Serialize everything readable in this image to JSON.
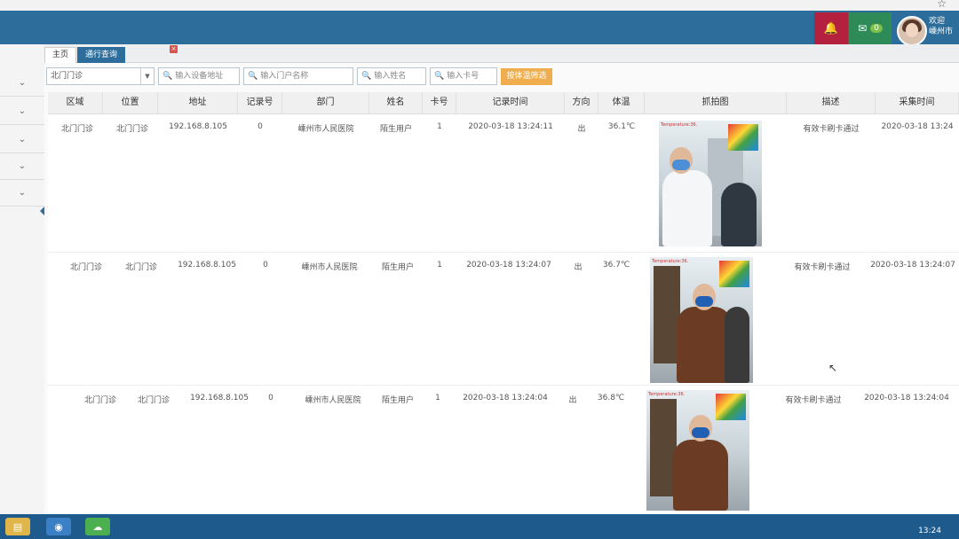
{
  "header": {
    "notifications_icon": "bell-icon",
    "mail_icon": "mail-icon",
    "mail_count": "0",
    "welcome_line1": "欢迎",
    "welcome_line2": "嵊州市"
  },
  "tabs": [
    {
      "label": "主页"
    },
    {
      "label": "通行查询"
    }
  ],
  "tab_close_glyph": "×",
  "filters": {
    "area_select": "北门门诊",
    "device_placeholder": "输入设备地址",
    "door_placeholder": "输入门户名称",
    "name_placeholder": "输入姓名",
    "card_placeholder": "输入卡号",
    "search_button": "按体温筛选"
  },
  "table": {
    "columns": [
      "区域",
      "位置",
      "地址",
      "记录号",
      "部门",
      "姓名",
      "卡号",
      "记录时间",
      "方向",
      "体温",
      "抓拍图",
      "描述",
      "采集时间"
    ],
    "rows": [
      {
        "area": "北门门诊",
        "location": "北门门诊",
        "address": "192.168.8.105",
        "record_no": "0",
        "department": "嵊州市人民医院",
        "name": "陌生用户",
        "card": "1",
        "record_time": "2020-03-18 13:24:11",
        "direction": "出",
        "temp": "36.1℃",
        "desc": "有效卡刷卡通过",
        "collect_time": "2020-03-18 13:24"
      },
      {
        "area": "北门门诊",
        "location": "北门门诊",
        "address": "192.168.8.105",
        "record_no": "0",
        "department": "嵊州市人民医院",
        "name": "陌生用户",
        "card": "1",
        "record_time": "2020-03-18 13:24:07",
        "direction": "出",
        "temp": "36.7℃",
        "desc": "有效卡刷卡通过",
        "collect_time": "2020-03-18 13:24:07"
      },
      {
        "area": "北门门诊",
        "location": "北门门诊",
        "address": "192.168.8.105",
        "record_no": "0",
        "department": "嵊州市人民医院",
        "name": "陌生用户",
        "card": "1",
        "record_time": "2020-03-18 13:24:04",
        "direction": "出",
        "temp": "36.8℃",
        "desc": "有效卡刷卡通过",
        "collect_time": "2020-03-18 13:24:04"
      }
    ]
  },
  "photo_banner": "Temperature:36.",
  "taskbar": {
    "clock": "13:24"
  },
  "colors": {
    "header_bg": "#2c6d9b",
    "bell_bg": "#b3213f",
    "mail_bg": "#2e8b57",
    "search_btn_bg": "#f0ad4e"
  }
}
